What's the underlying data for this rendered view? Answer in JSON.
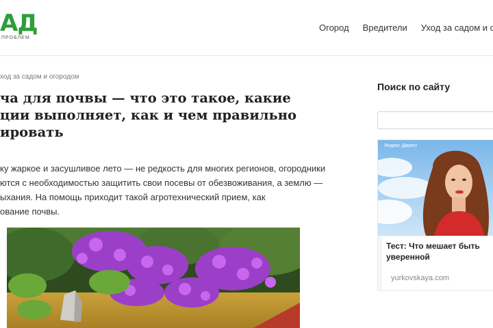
{
  "header": {
    "logo_text": "АД",
    "logo_tagline": "ПРОБЛЕМ",
    "nav": [
      "Огород",
      "Вредители",
      "Уход за садом и о"
    ]
  },
  "breadcrumb": "ход за садом и огородом",
  "article": {
    "title": "ча для почвы — что это такое, какие\nции выполняет, как и чем правильно\nировать",
    "intro": "ку жаркое и засушливое лето — не редкость для многих регионов, огородники\nются с необходимостью защитить свои посевы от обезвоживания, а землю —\nыхания. На помощь приходит такой агротехнический прием, как\nование почвы."
  },
  "sidebar": {
    "title": "Поиск по сайту",
    "search_value": ""
  },
  "ad": {
    "label": "Яндекс Директ",
    "headline": "Тест: Что мешает быть уверенной",
    "domain": "yurkovskaya.com"
  },
  "colors": {
    "logo_green": "#2e9e3a",
    "divider": "#e6e6e6"
  }
}
